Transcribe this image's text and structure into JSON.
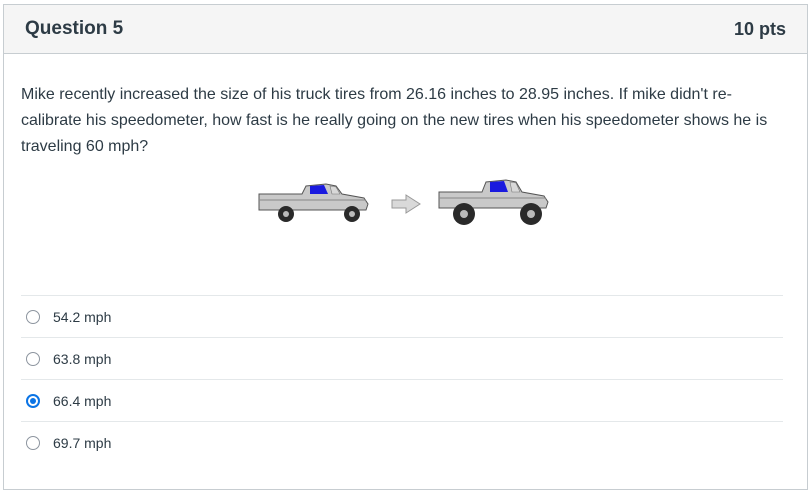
{
  "question": {
    "title": "Question 5",
    "points": "10 pts",
    "text": "Mike recently increased the size of his truck tires from 26.16 inches to 28.95 inches. If mike didn't re-calibrate his speedometer, how fast is he really going on the new tires when his speedometer shows he is traveling 60 mph?"
  },
  "image": {
    "icons": [
      "truck-icon",
      "arrow-right-icon",
      "lifted-truck-icon"
    ],
    "colors": {
      "truck_body": "#c9c9c9",
      "cab_window": "#1a1adf",
      "tire": "#2a2a2a"
    }
  },
  "answers": [
    {
      "label": "54.2 mph",
      "selected": false
    },
    {
      "label": "63.8 mph",
      "selected": false
    },
    {
      "label": "66.4 mph",
      "selected": true
    },
    {
      "label": "69.7 mph",
      "selected": false
    }
  ],
  "colors": {
    "accent": "#0b74e5",
    "text": "#2d3b45",
    "header_bg": "#f5f5f5",
    "border": "#c7cdd1"
  }
}
